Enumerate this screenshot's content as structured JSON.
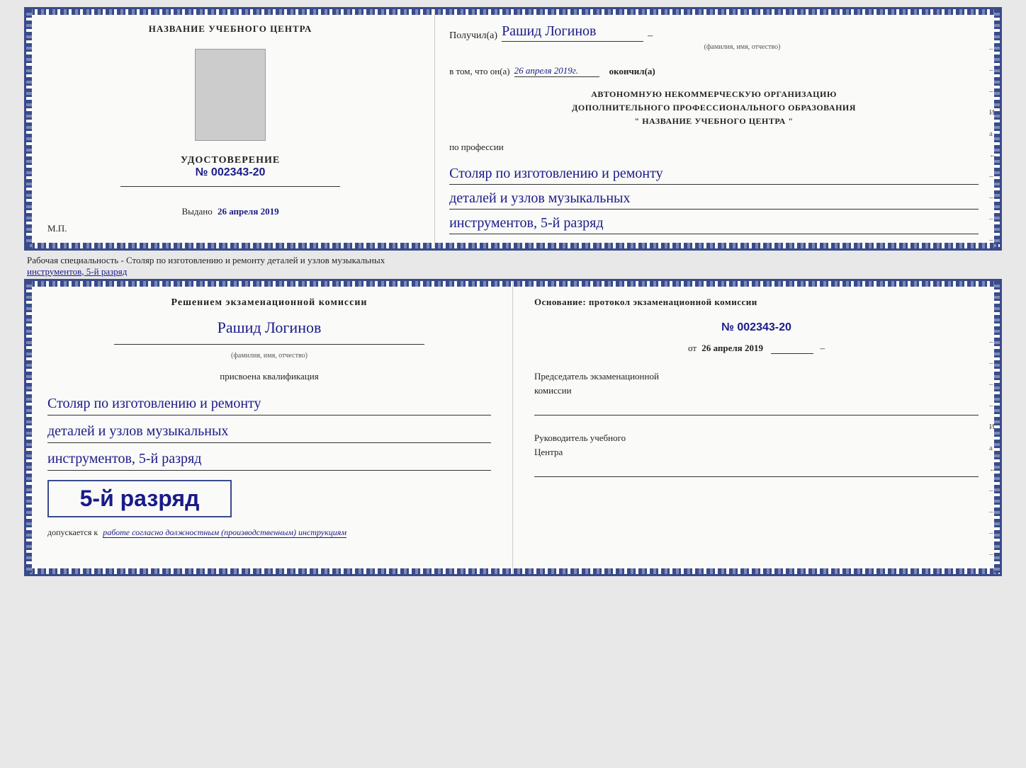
{
  "top_cert": {
    "left": {
      "org_name": "НАЗВАНИЕ УЧЕБНОГО ЦЕНТРА",
      "udostoverenie_title": "УДОСТОВЕРЕНИЕ",
      "number": "№ 002343-20",
      "vydano_label": "Выдано",
      "vydano_date": "26 апреля 2019",
      "mp": "М.П."
    },
    "right": {
      "poluchil_label": "Получил(а)",
      "poluchil_name": "Рашид Логинов",
      "poluchil_dash": "–",
      "fio_label": "(фамилия, имя, отчество)",
      "vtom_label": "в том, что он(а)",
      "vtom_date": "26 апреля 2019г.",
      "okonchil": "окончил(а)",
      "org_line1": "АВТОНОМНУЮ НЕКОММЕРЧЕСКУЮ ОРГАНИЗАЦИЮ",
      "org_line2": "ДОПОЛНИТЕЛЬНОГО ПРОФЕССИОНАЛЬНОГО ОБРАЗОВАНИЯ",
      "org_line3": "\"   НАЗВАНИЕ УЧЕБНОГО ЦЕНТРА   \"",
      "po_professii": "по профессии",
      "profession_line1": "Столяр по изготовлению и ремонту",
      "profession_line2": "деталей и узлов музыкальных",
      "profession_line3": "инструментов, 5-й разряд",
      "side_marks": [
        "-",
        "-",
        "-",
        "И",
        "а",
        "←",
        "-",
        "-",
        "-",
        "-"
      ]
    }
  },
  "between_label": {
    "text_normal": "Рабочая специальность - Столяр по изготовлению и ремонту деталей и узлов музыкальных",
    "text_underline": "инструментов, 5-й разряд"
  },
  "bottom_cert": {
    "left": {
      "resheniem_line1": "Решением  экзаменационной  комиссии",
      "name": "Рашид Логинов",
      "fio_label": "(фамилия, имя, отчество)",
      "prisvoena": "присвоена квалификация",
      "kval_line1": "Столяр по изготовлению и ремонту",
      "kval_line2": "деталей и узлов музыкальных",
      "kval_line3": "инструментов, 5-й разряд",
      "razryad_big": "5-й разряд",
      "dopuskaetsya_prefix": "допускается к",
      "dopuskaetsya_italic": "работе согласно должностным (производственным) инструкциям"
    },
    "right": {
      "osnovanie_label": "Основание: протокол экзаменационной  комиссии",
      "protocol_number": "№  002343-20",
      "ot_label": "от",
      "ot_date": "26 апреля 2019",
      "predsedatel_line1": "Председатель экзаменационной",
      "predsedatel_line2": "комиссии",
      "rukovoditel_line1": "Руководитель учебного",
      "rukovoditel_line2": "Центра",
      "side_marks": [
        "-",
        "-",
        "-",
        "-",
        "И",
        "а",
        "←",
        "-",
        "-",
        "-",
        "-"
      ]
    }
  }
}
